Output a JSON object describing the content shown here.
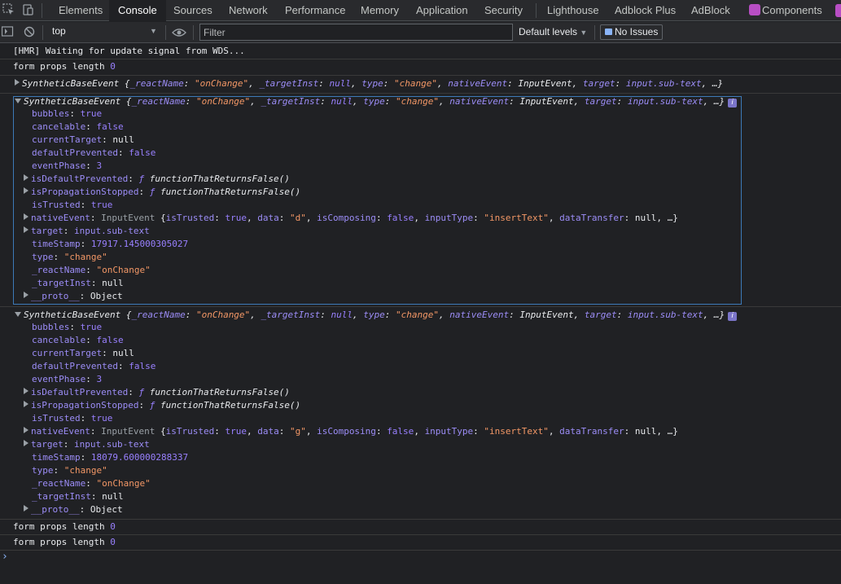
{
  "tabs": [
    {
      "label": "Elements"
    },
    {
      "label": "Console",
      "active": true
    },
    {
      "label": "Sources"
    },
    {
      "label": "Network"
    },
    {
      "label": "Performance"
    },
    {
      "label": "Memory"
    },
    {
      "label": "Application"
    },
    {
      "label": "Security"
    },
    {
      "label": "Lighthouse"
    },
    {
      "label": "Adblock Plus"
    },
    {
      "label": "AdBlock"
    },
    {
      "label": "Components",
      "icon": "react-icon"
    }
  ],
  "toolbar": {
    "context": "top",
    "filter_placeholder": "Filter",
    "levels": "Default levels",
    "issues": "No Issues"
  },
  "messages": {
    "hmr": "[HMR] Waiting for update signal from WDS...",
    "form_props": "form props length",
    "form_props_value": "0",
    "event_summary": {
      "class": "SyntheticBaseEvent",
      "reactName_key": "_reactName",
      "reactName_val": "\"onChange\"",
      "targetInst_key": "_targetInst",
      "targetInst_val": "null",
      "type_key": "type",
      "type_val": "\"change\"",
      "nativeEvent_key": "nativeEvent",
      "nativeEvent_val": "InputEvent",
      "target_key": "target",
      "target_val": "input.sub-text",
      "ellipsis": "…}"
    },
    "expanded": [
      {
        "bubbles": "true",
        "cancelable": "false",
        "currentTarget": "null",
        "defaultPrevented": "false",
        "eventPhase": "3",
        "isDefaultPrevented": "functionThatReturnsFalse()",
        "isPropagationStopped": "functionThatReturnsFalse()",
        "isTrusted": "true",
        "nativeEvent_type": "InputEvent",
        "nativeEvent_data": "\"d\"",
        "target": "input.sub-text",
        "timeStamp": "17917.145000305027",
        "type": "\"change\"",
        "reactName": "\"onChange\"",
        "targetInst": "null",
        "proto": "Object"
      },
      {
        "bubbles": "true",
        "cancelable": "false",
        "currentTarget": "null",
        "defaultPrevented": "false",
        "eventPhase": "3",
        "isDefaultPrevented": "functionThatReturnsFalse()",
        "isPropagationStopped": "functionThatReturnsFalse()",
        "isTrusted": "true",
        "nativeEvent_type": "InputEvent",
        "nativeEvent_data": "\"g\"",
        "target": "input.sub-text",
        "timeStamp": "18079.600000288337",
        "type": "\"change\"",
        "reactName": "\"onChange\"",
        "targetInst": "null",
        "proto": "Object"
      }
    ],
    "native_tail": {
      "isTrusted_key": "isTrusted",
      "isTrusted_val": "true",
      "data_key": "data",
      "isComposing_key": "isComposing",
      "isComposing_val": "false",
      "inputType_key": "inputType",
      "inputType_val": "\"insertText\"",
      "dataTransfer_key": "dataTransfer",
      "dataTransfer_val": "null",
      "ellipsis": "…}"
    }
  },
  "prompt_glyph": "›"
}
